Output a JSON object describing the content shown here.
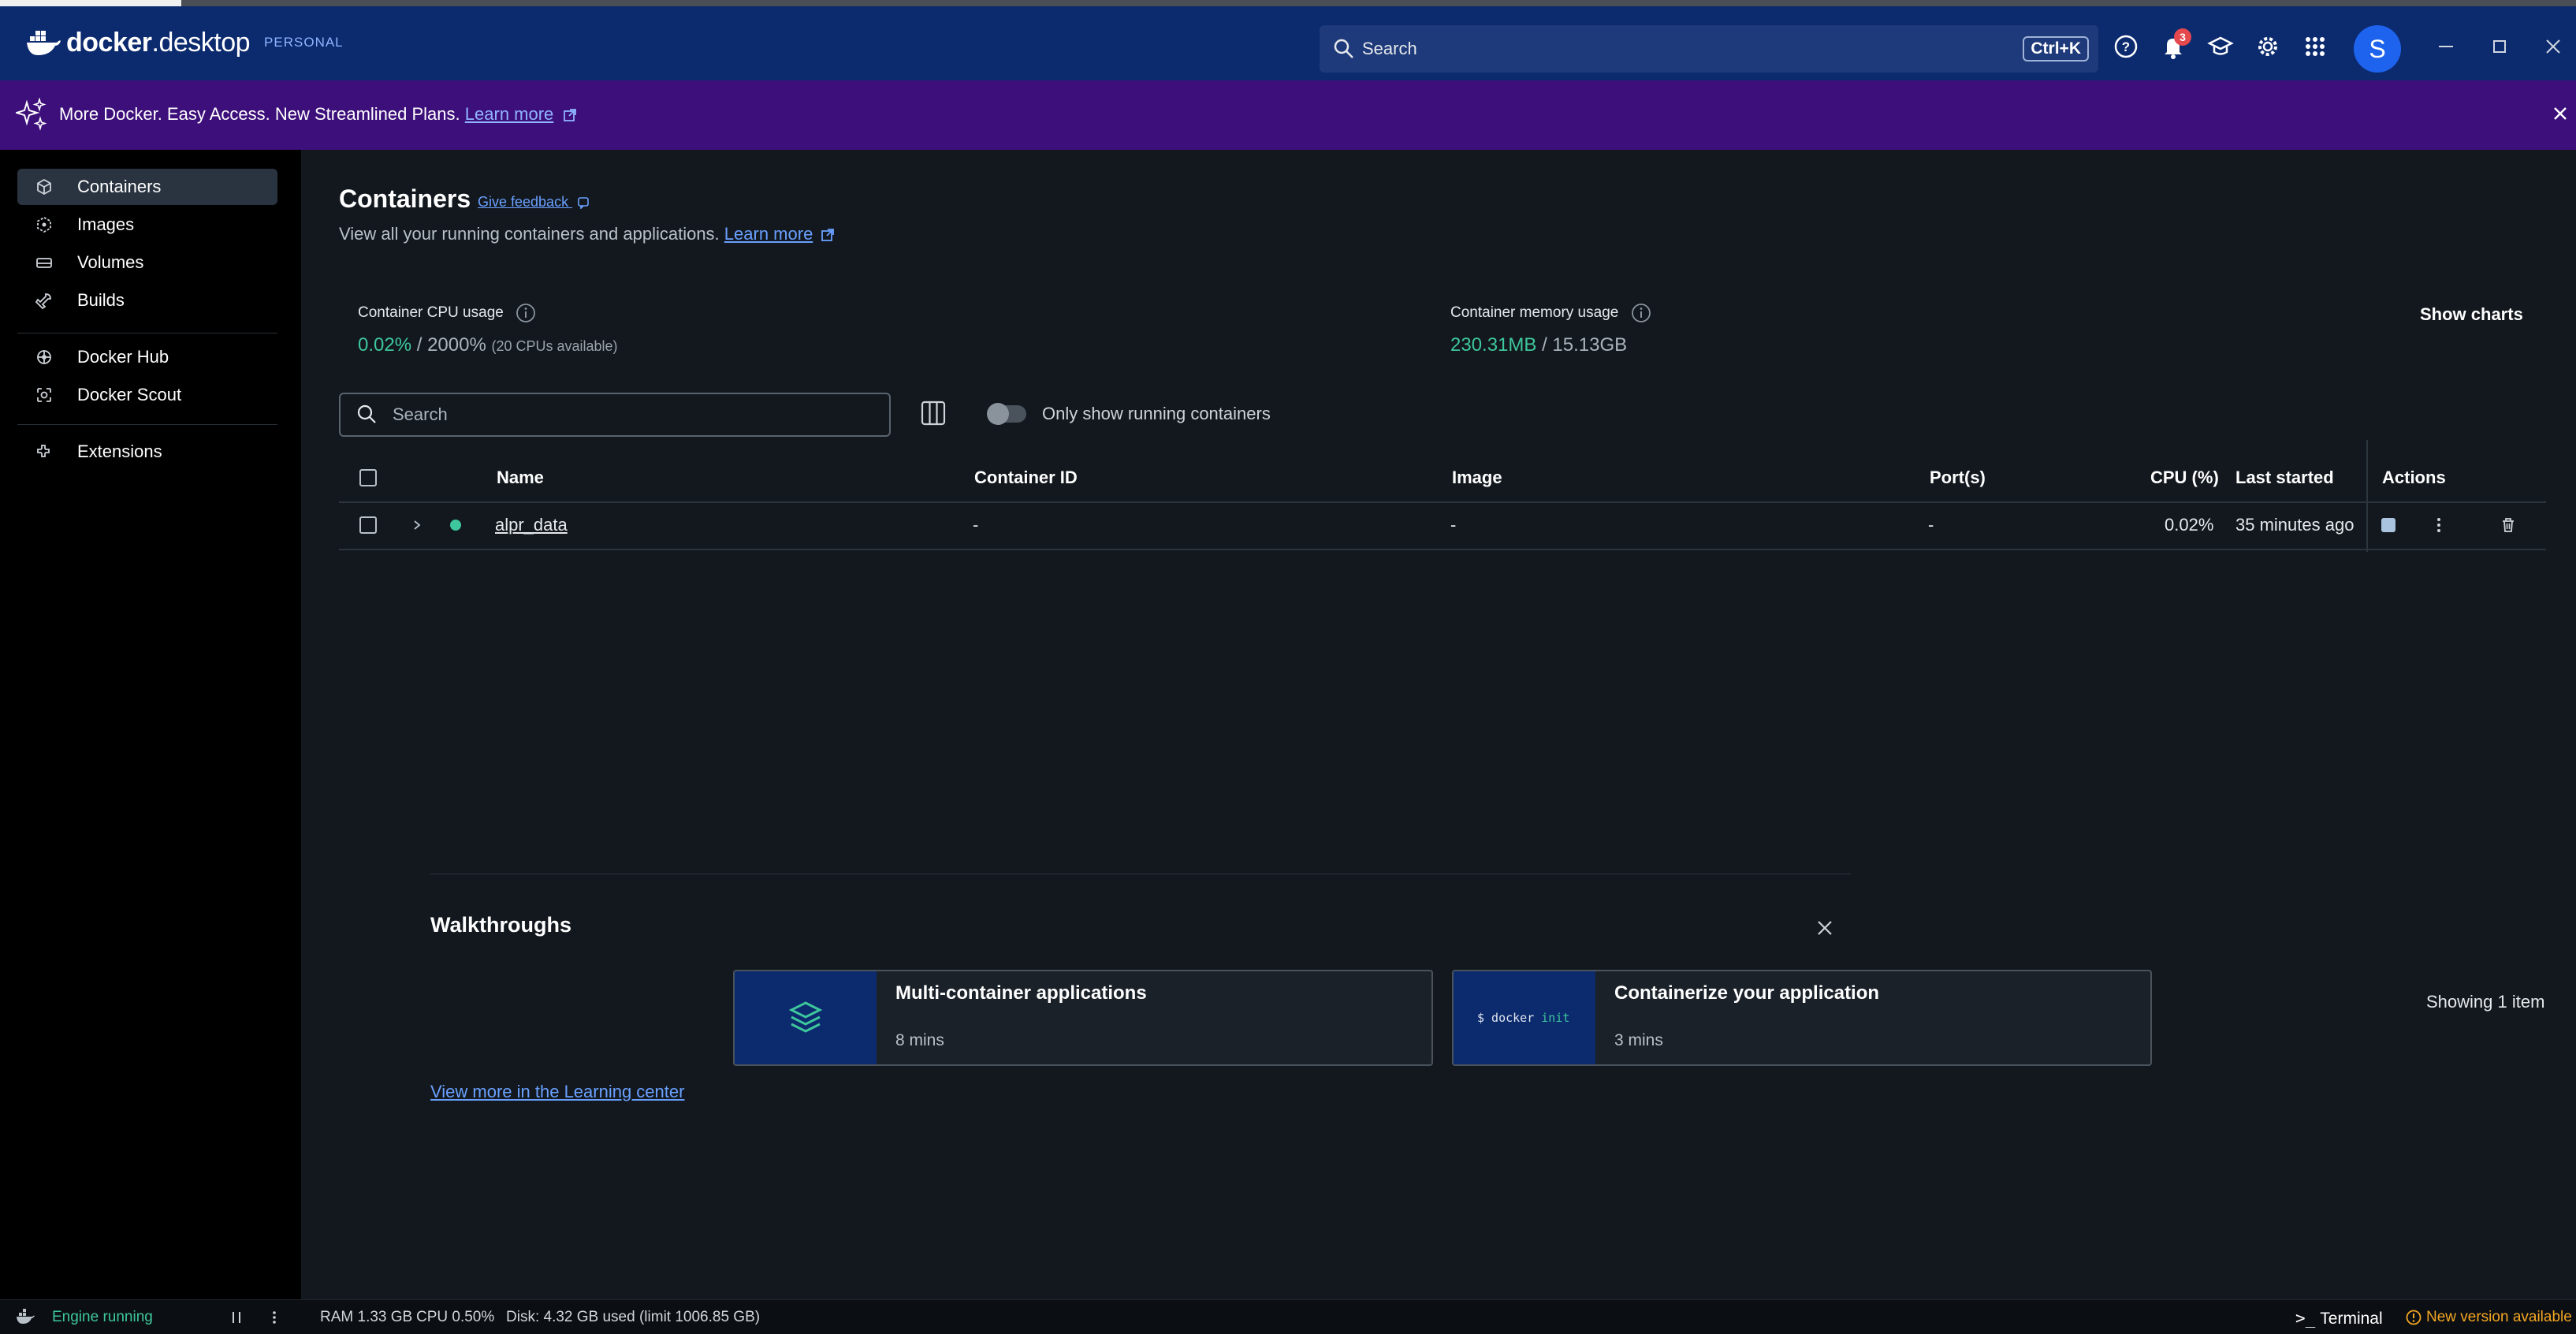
{
  "header": {
    "brand": "docker desktop",
    "brand_bold": "docker",
    "brand_light": "desktop",
    "plan": "PERSONAL",
    "search_placeholder": "Search",
    "search_shortcut": "Ctrl+K",
    "notification_count": "3",
    "avatar_initial": "S"
  },
  "banner": {
    "text": "More Docker. Easy Access. New Streamlined Plans.",
    "link": "Learn more"
  },
  "sidebar": {
    "items": [
      {
        "label": "Containers",
        "icon": "containers-icon",
        "active": true
      },
      {
        "label": "Images",
        "icon": "images-icon"
      },
      {
        "label": "Volumes",
        "icon": "volumes-icon"
      },
      {
        "label": "Builds",
        "icon": "builds-icon"
      },
      {
        "label": "Docker Hub",
        "icon": "docker-hub-icon"
      },
      {
        "label": "Docker Scout",
        "icon": "docker-scout-icon"
      },
      {
        "label": "Extensions",
        "icon": "extensions-icon"
      }
    ]
  },
  "main": {
    "title": "Containers",
    "feedback": "Give feedback",
    "subtitle": "View all your running containers and applications.",
    "subtitle_link": "Learn more",
    "cpu_label": "Container CPU usage",
    "cpu_used": "0.02%",
    "cpu_total": "/ 2000%",
    "cpu_note": "(20 CPUs available)",
    "mem_label": "Container memory usage",
    "mem_used": "230.31MB",
    "mem_total": "/ 15.13GB",
    "show_charts": "Show charts",
    "search_placeholder": "Search",
    "toggle_label": "Only show running containers",
    "columns": [
      "Name",
      "Container ID",
      "Image",
      "Port(s)",
      "CPU (%)",
      "Last started",
      "Actions"
    ],
    "rows": [
      {
        "name": "alpr_data",
        "container_id": "-",
        "image": "-",
        "ports": "-",
        "cpu": "0.02%",
        "last_started": "35 minutes ago",
        "status": "running"
      }
    ],
    "showing": "Showing 1 item"
  },
  "walkthroughs": {
    "title": "Walkthroughs",
    "cards": [
      {
        "title": "Multi-container applications",
        "duration": "8 mins"
      },
      {
        "title": "Containerize your application",
        "duration": "3 mins",
        "code_prefix": "$ docker",
        "code_cmd": "init"
      }
    ],
    "learn_link": "View more in the Learning center"
  },
  "footer": {
    "engine": "Engine running",
    "ram": "RAM 1.33 GB",
    "cpu": "CPU 0.50%",
    "disk": "Disk: 4.32 GB used (limit 1006.85 GB)",
    "terminal": "Terminal",
    "new_version": "New version available"
  },
  "colors": {
    "header_bg": "#0c2a6e",
    "banner_bg": "#3d0f7a",
    "accent_green": "#3ec79c",
    "link_blue": "#6aa0ff",
    "warning_orange": "#f5a623"
  }
}
